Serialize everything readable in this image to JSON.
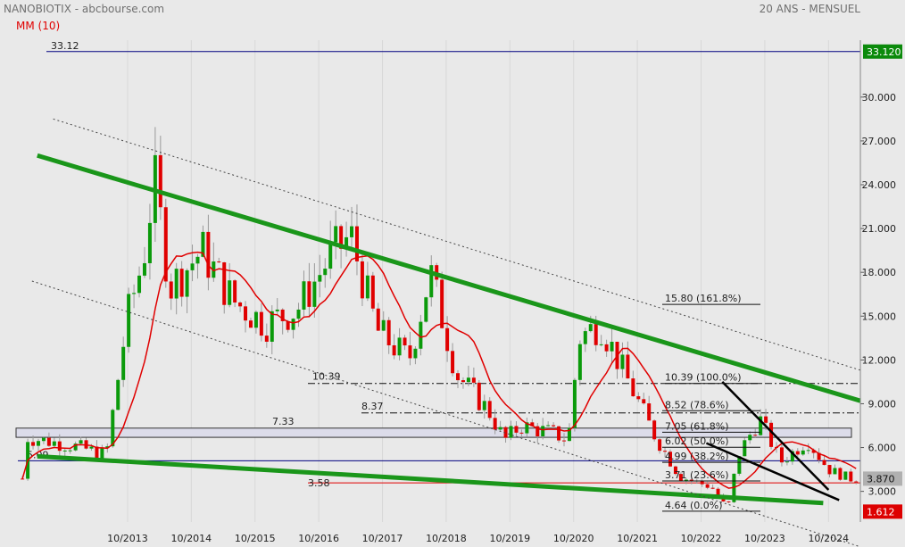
{
  "header": {
    "title": "NANOBIOTIX - abcbourse.com",
    "period": "20 ANS - MENSUEL",
    "ma_label": "MM (10)"
  },
  "colors": {
    "background": "#e9e9e9",
    "up": "#0a9a0a",
    "down": "#e00000",
    "ma": "#e00000",
    "trend": "#1a961a",
    "level": "#000080",
    "badge_green": "#0b8a0b",
    "badge_red": "#dd0000",
    "badge_gray": "#b0b0b0"
  },
  "chart_data": {
    "type": "candlestick",
    "y_ticks": [
      "3.000",
      "6.000",
      "9.000",
      "12.000",
      "15.000",
      "18.000",
      "21.000",
      "24.000",
      "27.000",
      "30.000"
    ],
    "x_ticks": [
      "10/2013",
      "10/2014",
      "10/2015",
      "10/2016",
      "10/2017",
      "10/2018",
      "10/2019",
      "10/2020",
      "10/2021",
      "10/2022",
      "10/2023",
      "10/2024"
    ],
    "price_badges": {
      "high": "33.120",
      "last": "3.870",
      "low": "1.612"
    },
    "level_labels": [
      {
        "text": "33.12",
        "value": 33.12
      },
      {
        "text": "5.09",
        "value": 5.09
      },
      {
        "text": "7.33",
        "value": 7.33
      },
      {
        "text": "3.58",
        "value": 3.58
      },
      {
        "text": "10.39",
        "value": 10.39
      },
      {
        "text": "8.37",
        "value": 8.37
      }
    ],
    "fibonacci": [
      {
        "text": "15.80  (161.8%)",
        "value": 15.8
      },
      {
        "text": "10.39  (100.0%)",
        "value": 10.39
      },
      {
        "text": "8.52  (78.6%)",
        "value": 8.52
      },
      {
        "text": "7.05  (61.8%)",
        "value": 7.05
      },
      {
        "text": "6.02  (50.0%)",
        "value": 6.02
      },
      {
        "text": "4.99  (38.2%)",
        "value": 4.99
      },
      {
        "text": "3.71  (23.6%)",
        "value": 3.71
      },
      {
        "text": "4.64  (0.0%)",
        "value": 1.64
      }
    ],
    "trendlines": [
      {
        "style": "green",
        "x0": "2012-05",
        "y0": 26.0,
        "x1": "2025-04",
        "y1": 9.2
      },
      {
        "style": "green",
        "x0": "2012-05",
        "y0": 5.4,
        "x1": "2024-09",
        "y1": 2.2
      },
      {
        "style": "dotted",
        "x0": "2012-08",
        "y0": 28.5,
        "x1": "2025-04",
        "y1": 11.3
      },
      {
        "style": "dotted",
        "x0": "2012-04",
        "y0": 17.4,
        "x1": "2025-04",
        "y1": -0.8
      },
      {
        "style": "black",
        "x0": "2023-02",
        "y0": 10.5,
        "x1": "2024-10",
        "y1": 3.1
      },
      {
        "style": "black",
        "x0": "2022-11",
        "y0": 6.3,
        "x1": "2024-12",
        "y1": 2.4
      }
    ],
    "candles_yearly_path": [
      {
        "x": "2012-03",
        "v": 6.7
      },
      {
        "x": "2012-12",
        "v": 6.1
      },
      {
        "x": "2013-06",
        "v": 5.5
      },
      {
        "x": "2013-10",
        "v": 15.0
      },
      {
        "x": "2014-01",
        "v": 19.0
      },
      {
        "x": "2014-03",
        "v": 24.5
      },
      {
        "x": "2014-06",
        "v": 17.0
      },
      {
        "x": "2014-12",
        "v": 19.5
      },
      {
        "x": "2015-06",
        "v": 16.0
      },
      {
        "x": "2015-12",
        "v": 14.5
      },
      {
        "x": "2016-06",
        "v": 15.5
      },
      {
        "x": "2016-12",
        "v": 19.0
      },
      {
        "x": "2017-04",
        "v": 20.5
      },
      {
        "x": "2017-09",
        "v": 14.0
      },
      {
        "x": "2018-03",
        "v": 12.0
      },
      {
        "x": "2018-07",
        "v": 18.0
      },
      {
        "x": "2018-12",
        "v": 11.0
      },
      {
        "x": "2019-06",
        "v": 8.5
      },
      {
        "x": "2019-09",
        "v": 6.5
      },
      {
        "x": "2019-12",
        "v": 7.5
      },
      {
        "x": "2020-06",
        "v": 7.0
      },
      {
        "x": "2020-09",
        "v": 6.5
      },
      {
        "x": "2020-11",
        "v": 13.5
      },
      {
        "x": "2021-03",
        "v": 14.5
      },
      {
        "x": "2021-05",
        "v": 13.0
      },
      {
        "x": "2021-09",
        "v": 10.0
      },
      {
        "x": "2022-01",
        "v": 7.0
      },
      {
        "x": "2022-06",
        "v": 4.0
      },
      {
        "x": "2022-12",
        "v": 3.3
      },
      {
        "x": "2023-03",
        "v": 1.8
      },
      {
        "x": "2023-05",
        "v": 5.5
      },
      {
        "x": "2023-09",
        "v": 8.0
      },
      {
        "x": "2024-01",
        "v": 5.0
      },
      {
        "x": "2024-06",
        "v": 6.5
      },
      {
        "x": "2024-10",
        "v": 4.5
      },
      {
        "x": "2025-02",
        "v": 3.87
      }
    ]
  }
}
